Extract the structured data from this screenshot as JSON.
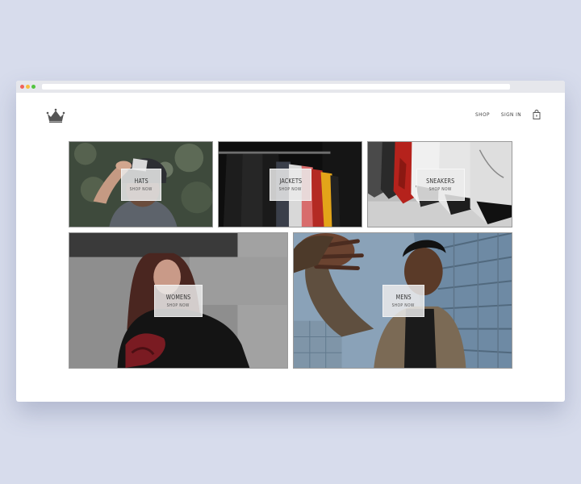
{
  "header": {
    "nav": {
      "shop": "SHOP",
      "sign_in": "SIGN IN"
    }
  },
  "categories": [
    {
      "title": "HATS",
      "cta": "SHOP NOW"
    },
    {
      "title": "JACKETS",
      "cta": "SHOP NOW"
    },
    {
      "title": "SNEAKERS",
      "cta": "SHOP NOW"
    },
    {
      "title": "WOMENS",
      "cta": "SHOP NOW"
    },
    {
      "title": "MENS",
      "cta": "SHOP NOW"
    }
  ],
  "colors": {
    "page_background": "#d7dcec",
    "window_background": "#ffffff",
    "overlay": "#ebebeb"
  }
}
